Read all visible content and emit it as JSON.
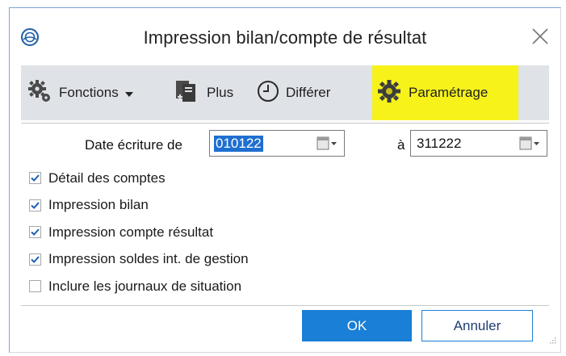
{
  "window": {
    "title": "Impression bilan/compte de résultat",
    "close_icon": "close-icon"
  },
  "toolbar": {
    "fonctions_label": "Fonctions",
    "plus_label": "Plus",
    "differer_label": "Différer",
    "parametrage_label": "Paramétrage",
    "highlight_color": "#f6f21a"
  },
  "date_range": {
    "from_label": "Date écriture de",
    "from_value": "010122",
    "to_label": "à",
    "to_value": "311222"
  },
  "options": [
    {
      "label": "Détail des comptes",
      "checked": true
    },
    {
      "label": "Impression bilan",
      "checked": true
    },
    {
      "label": "Impression compte résultat",
      "checked": true
    },
    {
      "label": "Impression soldes int. de gestion",
      "checked": true
    },
    {
      "label": "Inclure les journaux de situation",
      "checked": false
    }
  ],
  "buttons": {
    "ok_label": "OK",
    "cancel_label": "Annuler",
    "accent_color": "#1a7fd6"
  }
}
